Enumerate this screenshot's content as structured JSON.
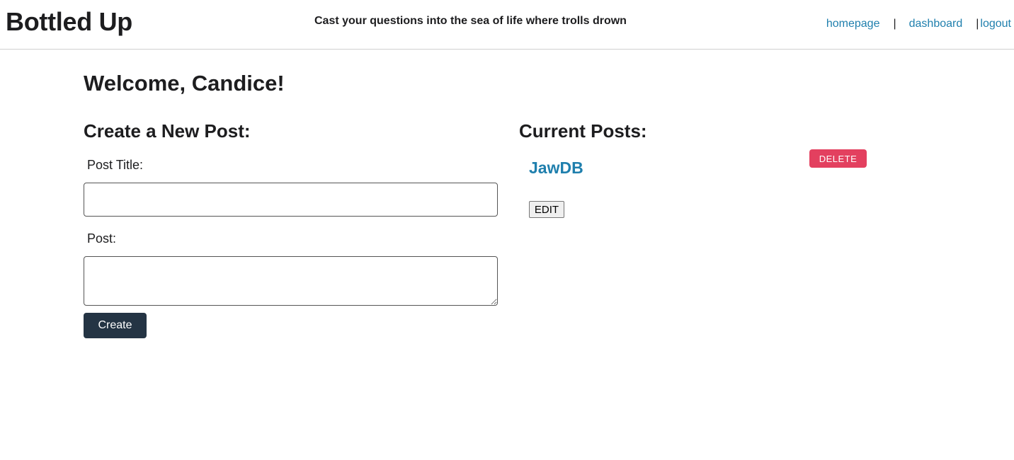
{
  "header": {
    "site_title": "Bottled Up",
    "tagline": "Cast your questions into the sea of life where trolls drown",
    "nav": {
      "homepage": "homepage",
      "separator": "|",
      "dashboard": "dashboard",
      "logout": "logout"
    }
  },
  "main": {
    "welcome": "Welcome, Candice!",
    "create_section": {
      "heading": "Create a New Post:",
      "title_label": "Post Title:",
      "title_value": "",
      "post_label": "Post:",
      "post_value": "",
      "create_button": "Create"
    },
    "current_section": {
      "heading": "Current Posts:",
      "posts": [
        {
          "title": "JawDB",
          "delete_label": "DELETE",
          "edit_label": "EDIT"
        }
      ]
    }
  },
  "colors": {
    "link": "#1f7fad",
    "create_button_bg": "#243444",
    "delete_button_bg": "#e3405f",
    "text": "#1d1d1f"
  }
}
